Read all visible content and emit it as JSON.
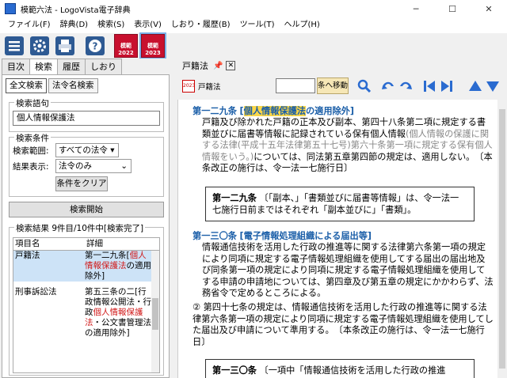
{
  "window": {
    "title": "模範六法 - LogoVista電子辞典",
    "minimize": "─",
    "maximize": "☐",
    "close": "✕"
  },
  "menu": [
    "ファイル(F)",
    "辞典(D)",
    "検索(S)",
    "表示(V)",
    "しおり・履歴(B)",
    "ツール(T)",
    "ヘルプ(H)"
  ],
  "toolbar": {
    "icons": [
      "list-icon",
      "settings-icon",
      "print-icon",
      "help-icon"
    ],
    "dicts": [
      {
        "top": "模範",
        "year": "2022"
      },
      {
        "top": "模範",
        "year": "2023"
      }
    ]
  },
  "left_tabs": [
    "目次",
    "検索",
    "履歴",
    "しおり"
  ],
  "search_tabs": [
    "全文検索",
    "法令名検索"
  ],
  "search": {
    "term_label": "検索語句",
    "term_value": "個人情報保護法",
    "conditions_label": "検索条件",
    "range_label": "検索範囲:",
    "range_value": "すべての法令",
    "display_label": "結果表示:",
    "display_value": "法令のみ",
    "clear_button": "条件をクリア",
    "start_button": "検索開始"
  },
  "results": {
    "label": "検索結果 9件目/10件中[検索完了]",
    "col_item": "項目名",
    "col_detail": "詳細",
    "rows": [
      {
        "item": "戸籍法",
        "detail_pre": "第一二九条[",
        "detail_hl": "個人情報保護法",
        "detail_post": "の適用除外]"
      },
      {
        "item": "刑事訴訟法",
        "detail_pre": "第五三条の二[行政情報公開法・行政",
        "detail_hl": "個人情報保護法",
        "detail_post": "・公文書管理法の適用除外]"
      }
    ]
  },
  "doc": {
    "tab_label": "戸籍法",
    "tab_close": "✕",
    "dict_name": "戸籍法",
    "dict_year": "2023",
    "jump_button": "条へ移動",
    "art129_head": "第一二九条",
    "art129_title_pre": "[",
    "art129_title_hl": "個人情報保護法",
    "art129_title_post": "の適用除外]",
    "art129_text1": "戸籍及び除かれた戸籍の正本及び副本、第四十八条第二項に規定する書類並びに届書等情報に記録されている保有個人情報",
    "art129_text_gray": "(個人情報の保護に関する法律(平成十五年法律第五十七号)第六十条第一項に規定する保有個人情報をいう。)",
    "art129_text2": "については、同法第五章第四節の規定は、適用しない。　〔本条改正の施行は、令一法一七施行日〕",
    "box1_head": "第一二九条",
    "box1_text": "〔「副本、」「書類並びに届書等情報」は、令一法一七施行日前まではそれぞれ「副本並びに」「書類」。",
    "art130_head": "第一三〇条",
    "art130_title": "[電子情報処理組織による届出等]",
    "art130_text1": "情報通信技術を活用した行政の推進等に関する法律第六条第一項の規定により同項に規定する電子情報処理組織を使用してする届出の届出地及び同条第一項の規定により同項に規定する電子情報処理組織を使用してする申請の申請地については、第四章及び第五章の規定にかかわらず、法務省令で定めるところによる。",
    "art130_num": "②",
    "art130_text2": "第四十七条の規定は、情報通信技術を活用した行政の推進等に関する法律第六条第一項の規定により同項に規定する電子情報処理組織を使用してした届出及び申請について準用する。　〔本条改正の施行は、令一法一七施行日〕",
    "box2_head": "第一三〇条",
    "box2_text": "〔一項中「情報通信技術を活用した行政の推進"
  }
}
